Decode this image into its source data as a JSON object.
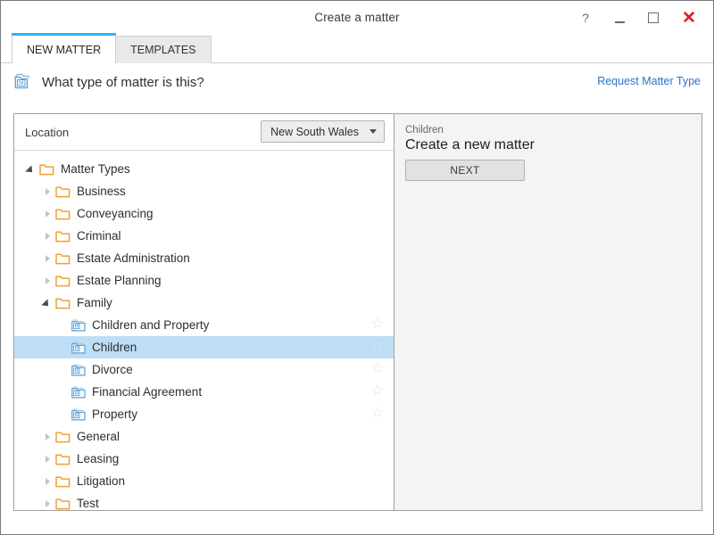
{
  "window": {
    "title": "Create a matter",
    "controls": [
      {
        "name": "help-button",
        "glyph": "?"
      },
      {
        "name": "minimize-button",
        "glyph": ""
      },
      {
        "name": "maximize-button",
        "glyph": ""
      },
      {
        "name": "close-button",
        "glyph": "✕"
      }
    ]
  },
  "tabs": [
    {
      "label": "NEW MATTER",
      "active": true
    },
    {
      "label": "TEMPLATES",
      "active": false
    }
  ],
  "header": {
    "icon": "matter-type-icon",
    "question": "What type of matter is this?",
    "request_link": "Request Matter Type"
  },
  "location": {
    "label": "Location",
    "selected": "New South Wales"
  },
  "tree": {
    "items": [
      {
        "label": "Matter Types",
        "depth": 0,
        "type": "folder",
        "state": "expanded",
        "selected": false,
        "star": false
      },
      {
        "label": "Business",
        "depth": 1,
        "type": "folder",
        "state": "collapsed",
        "selected": false,
        "star": false
      },
      {
        "label": "Conveyancing",
        "depth": 1,
        "type": "folder",
        "state": "collapsed",
        "selected": false,
        "star": false
      },
      {
        "label": "Criminal",
        "depth": 1,
        "type": "folder",
        "state": "collapsed",
        "selected": false,
        "star": false
      },
      {
        "label": "Estate Administration",
        "depth": 1,
        "type": "folder",
        "state": "collapsed",
        "selected": false,
        "star": false
      },
      {
        "label": "Estate Planning",
        "depth": 1,
        "type": "folder",
        "state": "collapsed",
        "selected": false,
        "star": false
      },
      {
        "label": "Family",
        "depth": 1,
        "type": "folder",
        "state": "expanded",
        "selected": false,
        "star": false
      },
      {
        "label": "Children and Property",
        "depth": 2,
        "type": "matter",
        "state": "leaf",
        "selected": false,
        "star": true
      },
      {
        "label": "Children",
        "depth": 2,
        "type": "matter",
        "state": "leaf",
        "selected": true,
        "star": true
      },
      {
        "label": "Divorce",
        "depth": 2,
        "type": "matter",
        "state": "leaf",
        "selected": false,
        "star": true
      },
      {
        "label": "Financial Agreement",
        "depth": 2,
        "type": "matter",
        "state": "leaf",
        "selected": false,
        "star": true
      },
      {
        "label": "Property",
        "depth": 2,
        "type": "matter",
        "state": "leaf",
        "selected": false,
        "star": true
      },
      {
        "label": "General",
        "depth": 1,
        "type": "folder",
        "state": "collapsed",
        "selected": false,
        "star": false
      },
      {
        "label": "Leasing",
        "depth": 1,
        "type": "folder",
        "state": "collapsed",
        "selected": false,
        "star": false
      },
      {
        "label": "Litigation",
        "depth": 1,
        "type": "folder",
        "state": "collapsed",
        "selected": false,
        "star": false
      },
      {
        "label": "Test",
        "depth": 1,
        "type": "folder",
        "state": "collapsed",
        "selected": false,
        "star": false
      }
    ],
    "star_glyph": "☆"
  },
  "details": {
    "subtitle": "Children",
    "title": "Create a new matter",
    "next_label": "NEXT"
  },
  "colors": {
    "accent_blue": "#29b6f6",
    "link_blue": "#2a72c8",
    "folder_orange": "#f0a030",
    "selection_blue": "#bedef5",
    "close_red": "#e01b24",
    "panel_gray": "#f4f4f2"
  }
}
